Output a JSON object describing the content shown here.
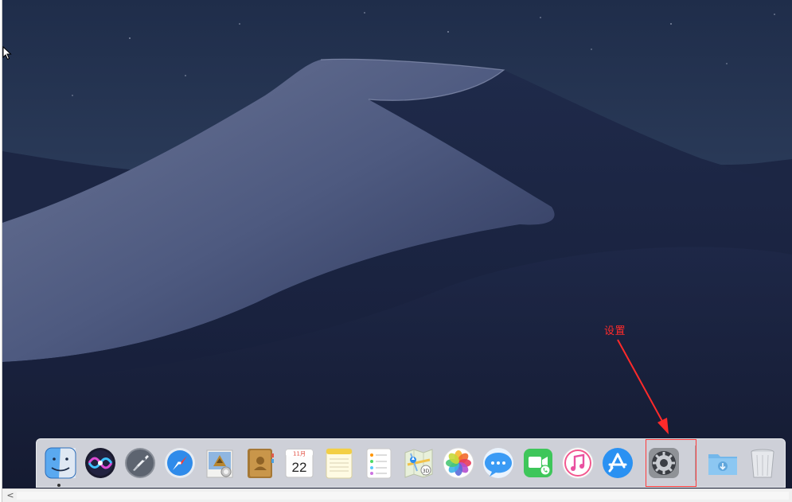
{
  "annotation": {
    "label": "设置",
    "color": "#ff2a2a"
  },
  "calendar": {
    "month": "11月",
    "day": "22"
  },
  "dock": {
    "items": [
      {
        "name": "finder-icon",
        "running": true
      },
      {
        "name": "siri-icon"
      },
      {
        "name": "launchpad-icon"
      },
      {
        "name": "safari-icon"
      },
      {
        "name": "mail-icon"
      },
      {
        "name": "contacts-icon"
      },
      {
        "name": "calendar-icon"
      },
      {
        "name": "notes-icon"
      },
      {
        "name": "reminders-icon"
      },
      {
        "name": "maps-icon"
      },
      {
        "name": "photos-icon"
      },
      {
        "name": "messages-icon"
      },
      {
        "name": "facetime-icon"
      },
      {
        "name": "itunes-icon"
      },
      {
        "name": "app-store-icon"
      },
      {
        "name": "system-preferences-icon",
        "highlighted": true
      },
      {
        "name": "downloads-folder-icon"
      },
      {
        "name": "trash-icon"
      }
    ]
  },
  "scrollbar": {
    "left_arrow": "<"
  }
}
